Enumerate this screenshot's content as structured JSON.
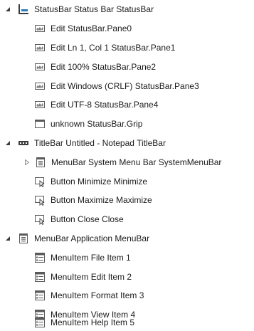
{
  "tree": {
    "statusbar": {
      "label": "StatusBar Status Bar StatusBar",
      "icon": "statusbar-icon",
      "expanded": true,
      "children": [
        {
          "label": "Edit  StatusBar.Pane0",
          "icon": "edit-icon"
        },
        {
          "label": "Edit   Ln 1, Col 1 StatusBar.Pane1",
          "icon": "edit-icon"
        },
        {
          "label": "Edit  100% StatusBar.Pane2",
          "icon": "edit-icon"
        },
        {
          "label": "Edit  Windows (CRLF) StatusBar.Pane3",
          "icon": "edit-icon"
        },
        {
          "label": "Edit  UTF-8 StatusBar.Pane4",
          "icon": "edit-icon"
        },
        {
          "label": "unknown StatusBar.Grip",
          "icon": "window-icon"
        }
      ]
    },
    "titlebar": {
      "label": "TitleBar Untitled - Notepad TitleBar",
      "icon": "titlebar-icon",
      "expanded": true,
      "children": [
        {
          "label": "MenuBar System Menu Bar SystemMenuBar",
          "icon": "menubar-icon",
          "collapsed": true
        },
        {
          "label": "Button Minimize Minimize",
          "icon": "button-icon"
        },
        {
          "label": "Button Maximize Maximize",
          "icon": "button-icon"
        },
        {
          "label": "Button Close Close",
          "icon": "button-icon"
        }
      ]
    },
    "menubar": {
      "label": "MenuBar Application MenuBar",
      "icon": "menubar-icon",
      "expanded": true,
      "children": [
        {
          "label": "MenuItem File Item 1",
          "icon": "menuitem-icon"
        },
        {
          "label": "MenuItem Edit Item 2",
          "icon": "menuitem-icon"
        },
        {
          "label": "MenuItem Format Item 3",
          "icon": "menuitem-icon"
        },
        {
          "label": "MenuItem View Item 4",
          "icon": "menuitem-icon"
        },
        {
          "label": "MenuItem Help Item 5",
          "icon": "menuitem-icon"
        }
      ]
    }
  },
  "colors": {
    "text": "#1b1b1b",
    "expand_glyph": "#3c3c3c",
    "collapse_glyph": "#8a8a8a",
    "icon_gray": "#5a5a5a",
    "icon_blue": "#2a7ab8"
  }
}
